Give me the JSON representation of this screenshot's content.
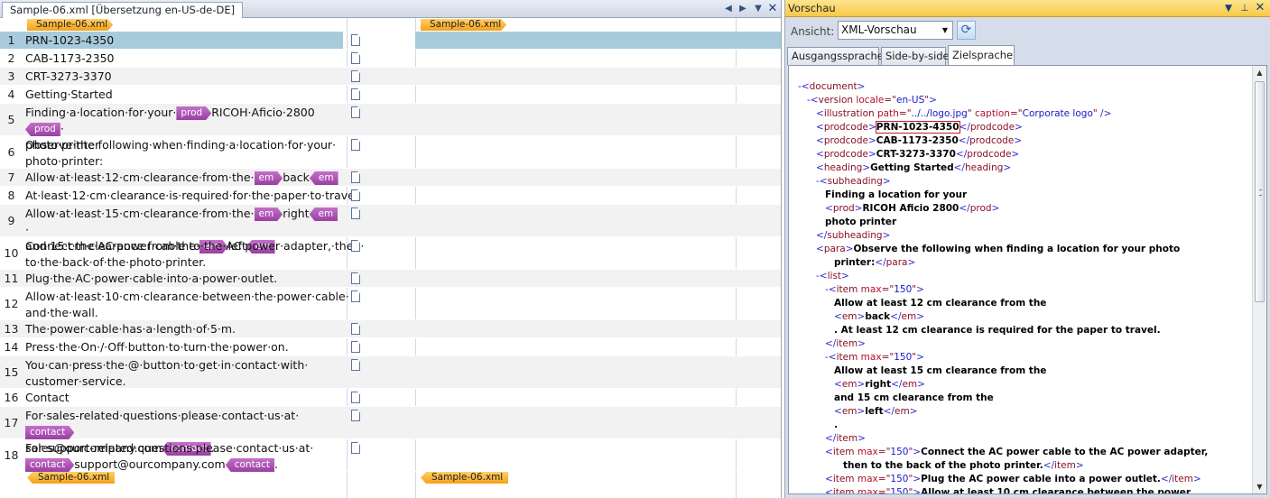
{
  "editor": {
    "tab_title": "Sample-06.xml [Übersetzung en-US-de-DE]",
    "file_tag": "Sample-06.xml",
    "colors": {
      "selected_row": "#a7cbdb",
      "tag": "#b05ab6",
      "file_tag": "#f7a520"
    },
    "rows": [
      {
        "num": "1",
        "parts": [
          {
            "t": "PRN-1023-4350"
          }
        ]
      },
      {
        "num": "2",
        "parts": [
          {
            "t": "CAB-1173-2350"
          }
        ]
      },
      {
        "num": "3",
        "parts": [
          {
            "t": "CRT-3273-3370"
          }
        ]
      },
      {
        "num": "4",
        "parts": [
          {
            "t": "Getting·Started"
          }
        ]
      },
      {
        "num": "5",
        "parts": [
          {
            "t": "Finding·a·location·for·your·"
          },
          {
            "tag": "prod"
          },
          {
            "t": "RICOH·Aficio·2800"
          },
          {
            "ctag": "prod"
          },
          {
            "t": "·"
          },
          {
            "br": true
          },
          {
            "t": "photo·printer"
          }
        ]
      },
      {
        "num": "6",
        "parts": [
          {
            "t": "Observe·the·following·when·finding·a·location·for·your·"
          },
          {
            "br": true
          },
          {
            "t": "photo·printer:"
          }
        ]
      },
      {
        "num": "7",
        "parts": [
          {
            "t": "Allow·at·least·12·cm·clearance·from·the·"
          },
          {
            "tag": "em"
          },
          {
            "t": "back"
          },
          {
            "ctag": "em"
          },
          {
            "t": "."
          }
        ]
      },
      {
        "num": "8",
        "parts": [
          {
            "t": "At·least·12·cm·clearance·is·required·for·the·paper·to·travel."
          }
        ]
      },
      {
        "num": "9",
        "parts": [
          {
            "t": "Allow·at·least·15·cm·clearance·from·the·"
          },
          {
            "tag": "em"
          },
          {
            "t": "right"
          },
          {
            "ctag": "em"
          },
          {
            "t": "·"
          },
          {
            "br": true
          },
          {
            "t": "and·15·cm·clearance·from·the·"
          },
          {
            "tag": "em"
          },
          {
            "t": "left"
          },
          {
            "ctag": "em"
          },
          {
            "t": "."
          }
        ]
      },
      {
        "num": "10",
        "parts": [
          {
            "t": "Connect·the·AC·power·cable·to·the·AC·power·adapter,·then·"
          },
          {
            "br": true
          },
          {
            "t": "to·the·back·of·the·photo·printer."
          }
        ]
      },
      {
        "num": "11",
        "parts": [
          {
            "t": "Plug·the·AC·power·cable·into·a·power·outlet."
          }
        ]
      },
      {
        "num": "12",
        "parts": [
          {
            "t": "Allow·at·least·10·cm·clearance·between·the·power·cable·"
          },
          {
            "br": true
          },
          {
            "t": "and·the·wall."
          }
        ]
      },
      {
        "num": "13",
        "parts": [
          {
            "t": "The·power·cable·has·a·length·of·5·m."
          }
        ]
      },
      {
        "num": "14",
        "parts": [
          {
            "t": "Press·the·On·/·Off·button·to·turn·the·power·on."
          }
        ]
      },
      {
        "num": "15",
        "parts": [
          {
            "t": "You·can·press·the·@·button·to·get·in·contact·with·"
          },
          {
            "br": true
          },
          {
            "t": "customer·service."
          }
        ]
      },
      {
        "num": "16",
        "parts": [
          {
            "t": "Contact"
          }
        ]
      },
      {
        "num": "17",
        "parts": [
          {
            "t": "For·sales-related·questions·please·contact·us·at·"
          },
          {
            "tag": "contact"
          },
          {
            "br": true
          },
          {
            "t": "sales@ourcompany.com"
          },
          {
            "ctag": "contact"
          },
          {
            "t": "."
          }
        ]
      },
      {
        "num": "18",
        "parts": [
          {
            "t": "For·support-related·questions·please·contact·us·at·"
          },
          {
            "br": true
          },
          {
            "tag": "contact"
          },
          {
            "t": "support@ourcompany.com"
          },
          {
            "ctag": "contact"
          },
          {
            "t": "."
          }
        ]
      }
    ]
  },
  "preview": {
    "title": "Vorschau",
    "view_label": "Ansicht:",
    "view_value": "XML-Vorschau",
    "tabs": [
      "Ausgangssprache",
      "Side-by-side",
      "Zielsprache"
    ],
    "active_tab": 2,
    "colors": {
      "title_bar": "#f9d565",
      "tag": "#2c2cd0",
      "attr_name": "#b3102e",
      "highlight": "#c0202a"
    },
    "xml_lines": [
      {
        "ind": 0,
        "s": [
          [
            "m",
            "-"
          ],
          [
            "t",
            "<document>"
          ]
        ]
      },
      {
        "ind": 1,
        "s": [
          [
            "m",
            "-"
          ],
          [
            "t",
            "<version "
          ],
          [
            "an",
            "locale"
          ],
          [
            "t",
            "=\""
          ],
          [
            "av",
            "en-US"
          ],
          [
            "t",
            "\">"
          ]
        ]
      },
      {
        "ind": 2,
        "s": [
          [
            "t",
            "<illustration "
          ],
          [
            "an",
            "path"
          ],
          [
            "t",
            "=\""
          ],
          [
            "av",
            "../../logo.jpg"
          ],
          [
            "t",
            "\" "
          ],
          [
            "an",
            "caption"
          ],
          [
            "t",
            "=\""
          ],
          [
            "av",
            "Corporate logo"
          ],
          [
            "t",
            "\" />"
          ]
        ]
      },
      {
        "ind": 2,
        "s": [
          [
            "t",
            "<prodcode>"
          ],
          [
            "bx",
            "PRN-1023-4350"
          ],
          [
            "t",
            "</prodcode>"
          ]
        ]
      },
      {
        "ind": 2,
        "s": [
          [
            "t",
            "<prodcode>"
          ],
          [
            "x",
            "CAB-1173-2350"
          ],
          [
            "t",
            "</prodcode>"
          ]
        ]
      },
      {
        "ind": 2,
        "s": [
          [
            "t",
            "<prodcode>"
          ],
          [
            "x",
            "CRT-3273-3370"
          ],
          [
            "t",
            "</prodcode>"
          ]
        ]
      },
      {
        "ind": 2,
        "s": [
          [
            "t",
            "<heading>"
          ],
          [
            "x",
            "Getting Started"
          ],
          [
            "t",
            "</heading>"
          ]
        ]
      },
      {
        "ind": 2,
        "s": [
          [
            "m",
            "-"
          ],
          [
            "t",
            "<subheading>"
          ]
        ]
      },
      {
        "ind": 3,
        "s": [
          [
            "x",
            "Finding a location for your"
          ]
        ]
      },
      {
        "ind": 3,
        "s": [
          [
            "t",
            "<prod>"
          ],
          [
            "x",
            "RICOH Aficio 2800"
          ],
          [
            "t",
            "</prod>"
          ]
        ]
      },
      {
        "ind": 3,
        "s": [
          [
            "x",
            "photo printer"
          ]
        ]
      },
      {
        "ind": 2,
        "s": [
          [
            "t",
            "</subheading>"
          ]
        ]
      },
      {
        "ind": 2,
        "s": [
          [
            "t",
            "<para>"
          ],
          [
            "x",
            "Observe the following when finding a location for your photo"
          ]
        ]
      },
      {
        "ind": 4,
        "s": [
          [
            "x",
            "printer:"
          ],
          [
            "t",
            "</para>"
          ]
        ]
      },
      {
        "ind": 2,
        "s": [
          [
            "m",
            "-"
          ],
          [
            "t",
            "<list>"
          ]
        ]
      },
      {
        "ind": 3,
        "s": [
          [
            "m",
            "-"
          ],
          [
            "t",
            "<item "
          ],
          [
            "an",
            "max"
          ],
          [
            "t",
            "=\""
          ],
          [
            "av",
            "150"
          ],
          [
            "t",
            "\">"
          ]
        ]
      },
      {
        "ind": 4,
        "s": [
          [
            "x",
            "Allow at least 12 cm clearance from the"
          ]
        ]
      },
      {
        "ind": 4,
        "s": [
          [
            "t",
            "<em>"
          ],
          [
            "x",
            "back"
          ],
          [
            "t",
            "</em>"
          ]
        ]
      },
      {
        "ind": 4,
        "s": [
          [
            "x",
            ". At least 12 cm clearance is required for the paper to travel."
          ]
        ]
      },
      {
        "ind": 3,
        "s": [
          [
            "t",
            "</item>"
          ]
        ]
      },
      {
        "ind": 3,
        "s": [
          [
            "m",
            "-"
          ],
          [
            "t",
            "<item "
          ],
          [
            "an",
            "max"
          ],
          [
            "t",
            "=\""
          ],
          [
            "av",
            "150"
          ],
          [
            "t",
            "\">"
          ]
        ]
      },
      {
        "ind": 4,
        "s": [
          [
            "x",
            "Allow at least 15 cm clearance from the"
          ]
        ]
      },
      {
        "ind": 4,
        "s": [
          [
            "t",
            "<em>"
          ],
          [
            "x",
            "right"
          ],
          [
            "t",
            "</em>"
          ]
        ]
      },
      {
        "ind": 4,
        "s": [
          [
            "x",
            "and 15 cm clearance from the"
          ]
        ]
      },
      {
        "ind": 4,
        "s": [
          [
            "t",
            "<em>"
          ],
          [
            "x",
            "left"
          ],
          [
            "t",
            "</em>"
          ]
        ]
      },
      {
        "ind": 4,
        "s": [
          [
            "x",
            "."
          ]
        ]
      },
      {
        "ind": 3,
        "s": [
          [
            "t",
            "</item>"
          ]
        ]
      },
      {
        "ind": 3,
        "s": [
          [
            "t",
            "<item "
          ],
          [
            "an",
            "max"
          ],
          [
            "t",
            "=\""
          ],
          [
            "av",
            "150"
          ],
          [
            "t",
            "\">"
          ],
          [
            "x",
            "Connect the AC power cable to the AC power adapter,"
          ]
        ]
      },
      {
        "ind": 5,
        "s": [
          [
            "x",
            "then to the back of the photo printer."
          ],
          [
            "t",
            "</item>"
          ]
        ]
      },
      {
        "ind": 3,
        "s": [
          [
            "t",
            "<item "
          ],
          [
            "an",
            "max"
          ],
          [
            "t",
            "=\""
          ],
          [
            "av",
            "150"
          ],
          [
            "t",
            "\">"
          ],
          [
            "x",
            "Plug the AC power cable into a power outlet."
          ],
          [
            "t",
            "</item>"
          ]
        ]
      },
      {
        "ind": 3,
        "s": [
          [
            "t",
            "<item "
          ],
          [
            "an",
            "max"
          ],
          [
            "t",
            "=\""
          ],
          [
            "av",
            "150"
          ],
          [
            "t",
            "\">"
          ],
          [
            "x",
            "Allow at least 10 cm clearance between the power"
          ]
        ]
      }
    ]
  }
}
